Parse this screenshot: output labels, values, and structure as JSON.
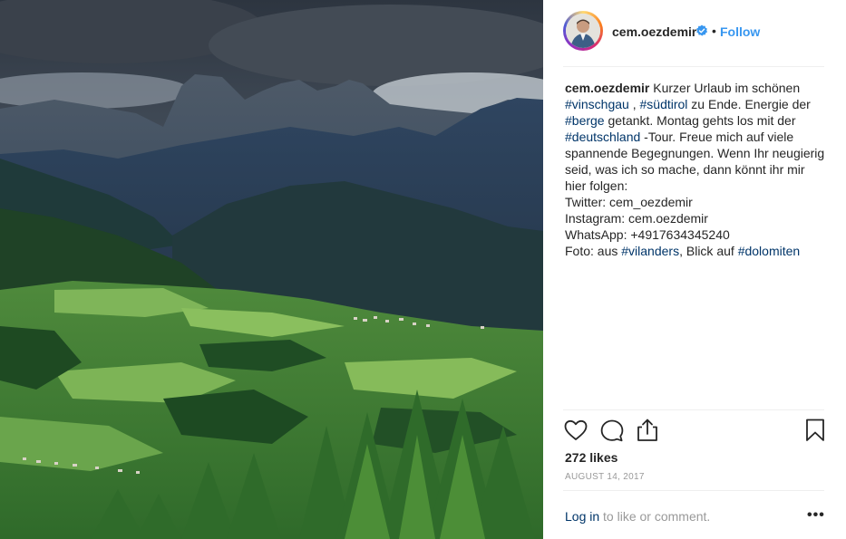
{
  "header": {
    "username": "cem.oezdemir",
    "separator": "•",
    "follow_label": "Follow"
  },
  "caption": {
    "username": "cem.oezdemir",
    "t1": " Kurzer Urlaub im schönen ",
    "h1": "#vinschgau",
    "t2": " , ",
    "h2": "#südtirol",
    "t3": " zu Ende. Energie der ",
    "h3": "#berge",
    "t4": " getankt. Montag gehts los mit der ",
    "h4": "#deutschland",
    "t5": " -Tour. Freue mich auf viele spannende Begegnungen. Wenn Ihr neugierig seid, was ich so mache, dann könnt ihr mir hier folgen:",
    "twitter": "Twitter: cem_oezdemir",
    "instagram": "Instagram: cem.oezdemir",
    "whatsapp": "WhatsApp: +4917634345240",
    "t6": "Foto: aus ",
    "h5": "#vilanders",
    "t7": ", Blick auf ",
    "h6": "#dolomiten"
  },
  "stats": {
    "likes": "272 likes",
    "date": "AUGUST 14, 2017"
  },
  "footer": {
    "login_label": "Log in",
    "login_suffix": " to like or comment.",
    "more_label": "•••"
  },
  "icons": {
    "like": "heart-icon",
    "comment": "comment-icon",
    "share": "share-icon",
    "save": "bookmark-icon",
    "verified": "verified-badge-icon"
  },
  "colors": {
    "link": "#003569",
    "follow": "#3897f0",
    "muted": "#999999",
    "text": "#262626"
  }
}
